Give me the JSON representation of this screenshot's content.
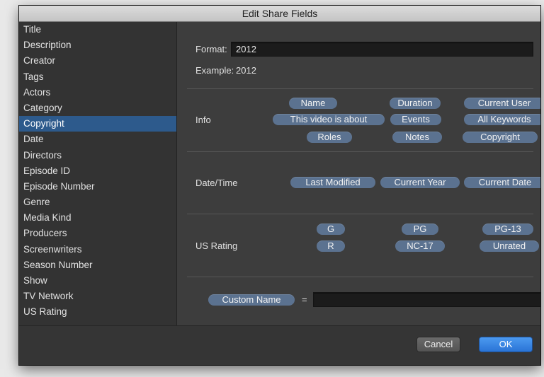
{
  "window": {
    "title": "Edit Share Fields"
  },
  "sidebar": {
    "items": [
      {
        "label": "Title"
      },
      {
        "label": "Description"
      },
      {
        "label": "Creator"
      },
      {
        "label": "Tags"
      },
      {
        "label": "Actors"
      },
      {
        "label": "Category"
      },
      {
        "label": "Copyright",
        "selected": true
      },
      {
        "label": "Date"
      },
      {
        "label": "Directors"
      },
      {
        "label": "Episode ID"
      },
      {
        "label": "Episode Number"
      },
      {
        "label": "Genre"
      },
      {
        "label": "Media Kind"
      },
      {
        "label": "Producers"
      },
      {
        "label": "Screenwriters"
      },
      {
        "label": "Season Number"
      },
      {
        "label": "Show"
      },
      {
        "label": "TV Network"
      },
      {
        "label": "US Rating"
      }
    ]
  },
  "format": {
    "label": "Format:",
    "value": "2012"
  },
  "example": {
    "label": "Example:",
    "value": "2012"
  },
  "info": {
    "label": "Info",
    "tokens": [
      "Name",
      "Duration",
      "Current User",
      "This video is about",
      "Events",
      "All Keywords",
      "Roles",
      "Notes",
      "Copyright"
    ]
  },
  "datetime": {
    "label": "Date/Time",
    "tokens": [
      "Last Modified",
      "Current Year",
      "Current Date"
    ]
  },
  "rating": {
    "label": "US Rating",
    "tokens": [
      "G",
      "PG",
      "PG-13",
      "R",
      "NC-17",
      "Unrated"
    ]
  },
  "custom": {
    "token": "Custom Name",
    "equals": "=",
    "value": ""
  },
  "footer": {
    "cancel_label": "Cancel",
    "ok_label": "OK"
  },
  "colors": {
    "token": "#5b7290",
    "selection": "#2d5a8c",
    "ok_button": "#2a74d6"
  }
}
